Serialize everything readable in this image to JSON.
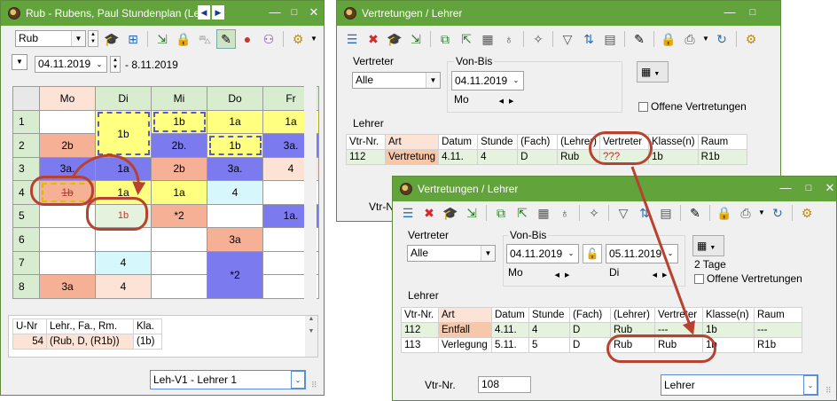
{
  "win1": {
    "title": "Rub - Rubens, Paul  Stundenplan  (Le",
    "element_combo": "Rub",
    "date_from": "04.11.2019",
    "date_to": "- 8.11.2019",
    "days": [
      "Mo",
      "Di",
      "Mi",
      "Do",
      "Fr"
    ],
    "hours": [
      "1",
      "2",
      "3",
      "4",
      "5",
      "6",
      "7",
      "8"
    ],
    "cells": {
      "mo1": "",
      "mo2": "2b",
      "mo3": "3a.",
      "mo4": "1b",
      "mo5": "",
      "mo6": "",
      "mo7": "",
      "mo8": "3a",
      "di12": "1b",
      "di3": "1a",
      "di4": "1a",
      "di5": "1b",
      "di6": "",
      "di7": "4",
      "di8": "4",
      "mi1": "1b",
      "mi2": "2b.",
      "mi3": "2b",
      "mi4": "1a",
      "mi5": "*2",
      "mi6": "",
      "mi7": "",
      "mi8": "",
      "do1": "1a",
      "do2": "1b",
      "do3": "3a.",
      "do4": "4",
      "do5": "",
      "do6": "3a",
      "do78": "*2",
      "fr1": "1a",
      "fr2": "3a.",
      "fr3": "4",
      "fr4": "",
      "fr5": "1a.",
      "fr6": "",
      "fr7": "",
      "fr8": ""
    },
    "bottom_headers": [
      "U-Nr",
      "Lehr., Fa., Rm.",
      "Kla."
    ],
    "bottom_row": [
      "54",
      "(Rub, D, (R1b))",
      "(1b)"
    ],
    "format_combo": "Leh-V1 - Lehrer 1"
  },
  "win2": {
    "title": "Vertretungen / Lehrer",
    "vertreter_label": "Vertreter",
    "vertreter_value": "Alle",
    "vonbis_label": "Von-Bis",
    "date": "04.11.2019",
    "day": "Mo",
    "offene": "Offene Vertretungen",
    "lehrer_label": "Lehrer",
    "headers": [
      "Vtr-Nr.",
      "Art",
      "Datum",
      "Stunde",
      "(Fach)",
      "(Lehrer)",
      "Vertreter",
      "Klasse(n)",
      "Raum"
    ],
    "row": [
      "112",
      "Vertretung",
      "4.11.",
      "4",
      "D",
      "Rub",
      "???",
      "1b",
      "R1b"
    ],
    "vtrnr_label": "Vtr-N"
  },
  "win3": {
    "title": "Vertretungen / Lehrer",
    "vertreter_label": "Vertreter",
    "vertreter_value": "Alle",
    "vonbis_label": "Von-Bis",
    "date_from": "04.11.2019",
    "date_to": "05.11.2019",
    "day_from": "Mo",
    "day_to": "Di",
    "tage": "2 Tage",
    "offene": "Offene Vertretungen",
    "lehrer_label": "Lehrer",
    "headers": [
      "Vtr-Nr.",
      "Art",
      "Datum",
      "Stunde",
      "(Fach)",
      "(Lehrer)",
      "Vertreter",
      "Klasse(n)",
      "Raum"
    ],
    "rows": [
      [
        "112",
        "Entfall",
        "4.11.",
        "4",
        "D",
        "Rub",
        "---",
        "1b",
        "---"
      ],
      [
        "113",
        "Verlegung",
        "5.11.",
        "5",
        "D",
        "Rub",
        "Rub",
        "1b",
        "R1b"
      ]
    ],
    "vtrnr_label": "Vtr-Nr.",
    "vtrnr_value": "108",
    "lehrer_combo": "Lehrer"
  },
  "colors": {
    "title_green": "#63a33b",
    "yellow": "#ffff80",
    "blue": "#7b7bef",
    "salmon": "#f6b096",
    "peach": "#fde2d6",
    "cyan": "#d6f7fb",
    "mint": "#e5f2dd",
    "header_green": "#d8ecd0",
    "annotation_red": "#b8412f"
  }
}
